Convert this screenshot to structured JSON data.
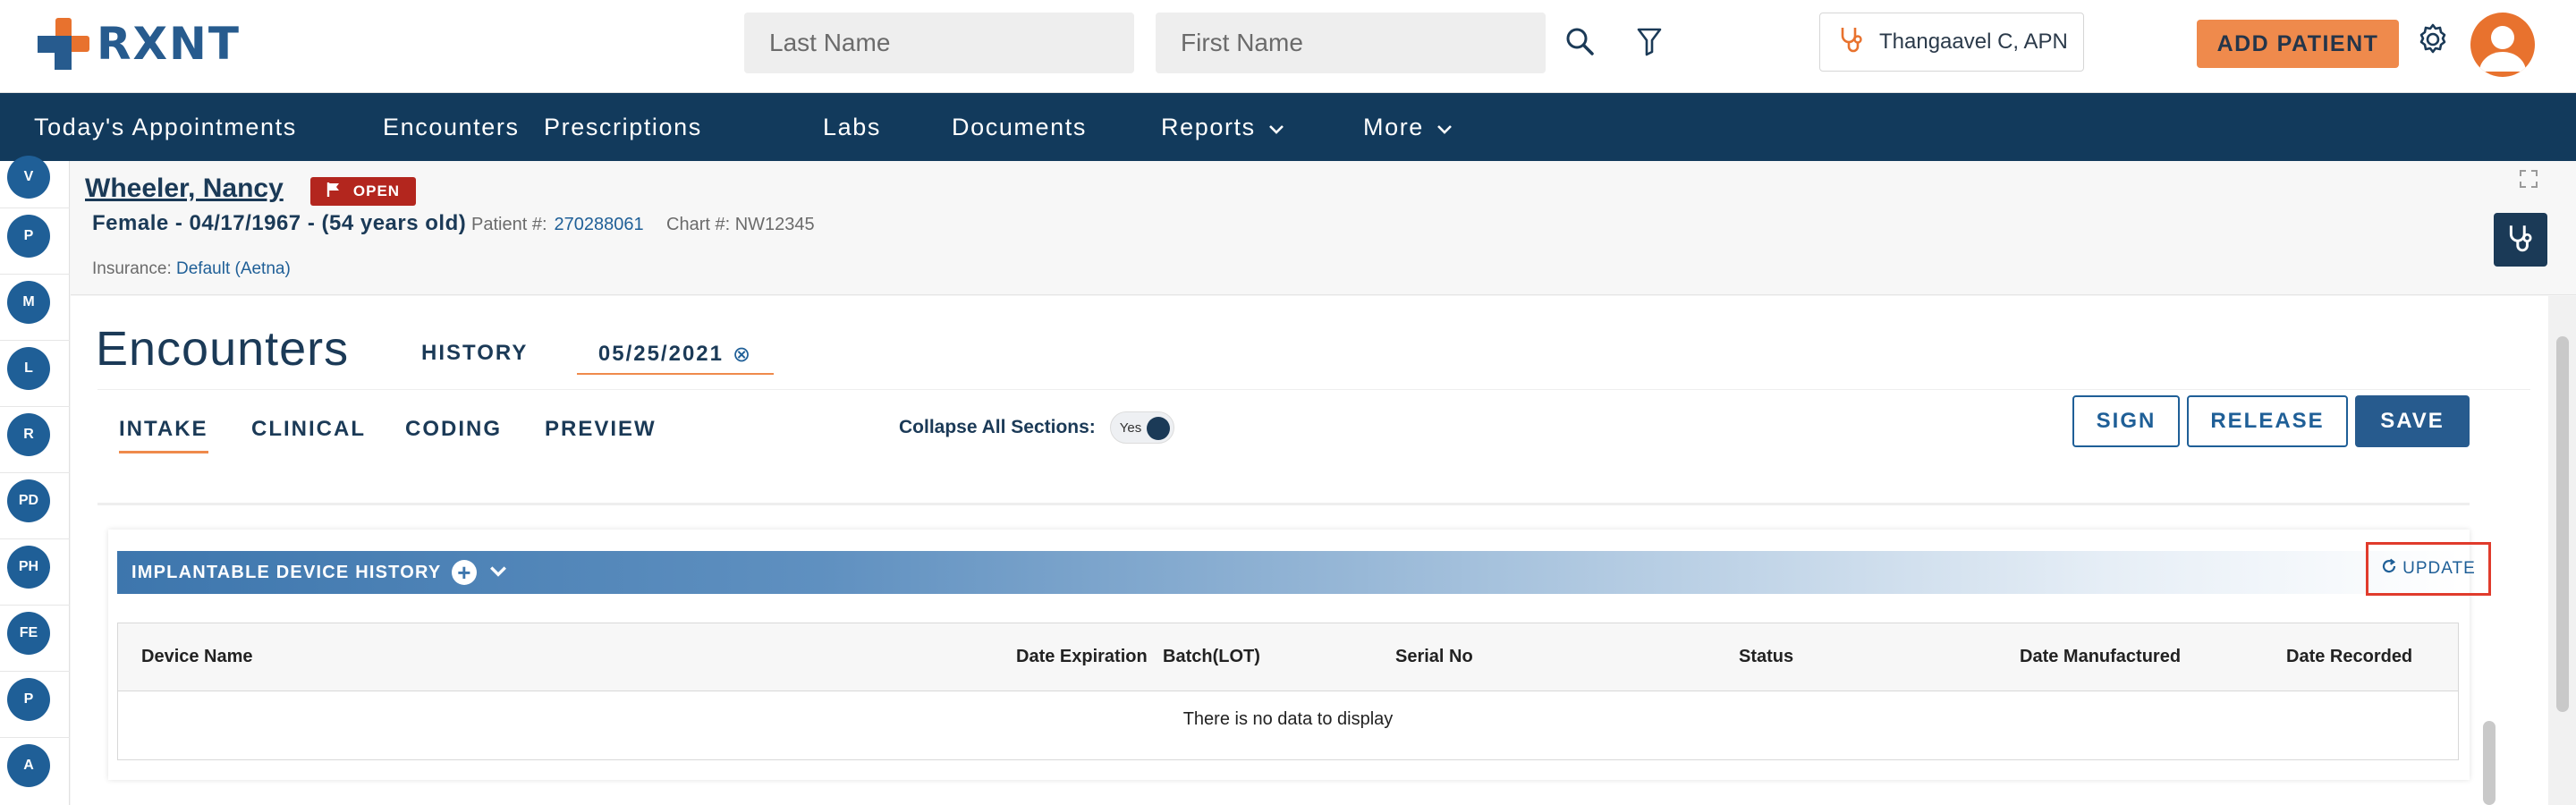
{
  "header": {
    "logo_text": "RXNT",
    "last_name_placeholder": "Last Name",
    "first_name_placeholder": "First Name",
    "provider_name": "Thangaavel C, APN",
    "add_patient_label": "ADD PATIENT",
    "colors": {
      "accent": "#ef8a4c",
      "brand": "#275b8e"
    }
  },
  "nav": {
    "items": [
      {
        "label": "Today's Appointments"
      },
      {
        "label": "Encounters"
      },
      {
        "label": "Prescriptions"
      },
      {
        "label": "Labs"
      },
      {
        "label": "Documents"
      },
      {
        "label": "Reports"
      },
      {
        "label": "More"
      }
    ],
    "background": "#123a5c"
  },
  "rail": {
    "items": [
      "V",
      "P",
      "M",
      "L",
      "R",
      "PD",
      "PH",
      "FE",
      "P",
      "A"
    ]
  },
  "patient": {
    "name": "Wheeler, Nancy",
    "status": "OPEN",
    "summary": "Female - 04/17/1967 - (54 years old)",
    "patient_no_label": "Patient #:",
    "patient_no": "270288061",
    "chart_no_label": "Chart #:",
    "chart_no": "NW12345",
    "insurance_label": "Insurance:",
    "insurance": "Default (Aetna)"
  },
  "encounter": {
    "title": "Encounters",
    "history_tab": "HISTORY",
    "date_tab": "05/25/2021",
    "sub_tabs": [
      "INTAKE",
      "CLINICAL",
      "CODING",
      "PREVIEW"
    ],
    "active_sub_tab": "INTAKE",
    "collapse_label": "Collapse All Sections:",
    "collapse_value": "Yes",
    "sign_label": "SIGN",
    "release_label": "RELEASE",
    "save_label": "SAVE"
  },
  "device_history": {
    "title": "IMPLANTABLE DEVICE HISTORY",
    "update_label": "UPDATE",
    "columns": [
      "Device Name",
      "Date Expiration",
      "Batch(LOT)",
      "Serial No",
      "Status",
      "Date Manufactured",
      "Date Recorded"
    ],
    "empty_message": "There is no data to display"
  }
}
